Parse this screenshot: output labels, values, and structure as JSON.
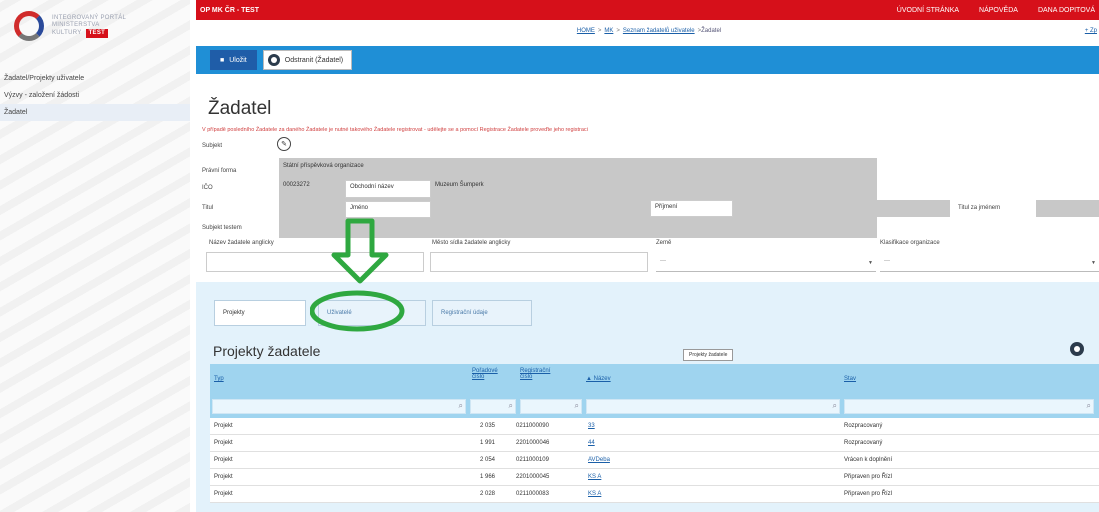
{
  "app": {
    "title": "OP MK ČR - TEST",
    "badge": "TEST",
    "logo_text": [
      "INTEGROVANÝ PORTÁL",
      "MINISTERSTVA",
      "KULTURY"
    ]
  },
  "top_links": [
    "ÚVODNÍ STRÁNKA",
    "NÁPOVĚDA",
    "DANA DOPITOVÁ"
  ],
  "breadcrumb": {
    "items": [
      "HOME",
      "MK",
      "Seznam žadatelů uživatele",
      "Žadatel"
    ],
    "right": "+ Zp"
  },
  "sidebar": {
    "items": [
      {
        "label": "Žadatel/Projekty uživatele"
      },
      {
        "label": "Výzvy - založení žádosti"
      },
      {
        "label": "Žadatel"
      }
    ]
  },
  "toolbar": {
    "save_label": "Uložit",
    "remove_label": "Odstranit (Žadatel)"
  },
  "page": {
    "title": "Žadatel",
    "warning": "V případě posledního Žadatele za daného Žadatele je nutné takového Žadatele registrovat - udělejte se a pomocí Registrace Žadatele proveďte jeho registraci"
  },
  "form": {
    "subjekt_label": "Subjekt",
    "pravni_forma_label": "Právní forma",
    "pravni_forma_value": "Státní příspěvková organizace",
    "ico_label": "IČO",
    "ico_value": "00023272",
    "obchodni_nazev_label": "Obchodní název",
    "obchodni_nazev_value": "Muzeum Šumperk",
    "jmeno_label": "Jméno",
    "prijmeni_label": "Příjmení",
    "titul_label": "Titul",
    "titul_za_label": "Titul za jménem",
    "subjekt_testem_label": "Subjekt testem",
    "nazev_anglicky_label": "Název žadatele anglicky",
    "mesto_anglicky_label": "Město sídla žadatele anglicky",
    "zeme_label": "Země",
    "zeme_value": "—",
    "klasifikace_label": "Klasifikace organizace",
    "klasifikace_value": "—"
  },
  "tabs": [
    {
      "label": "Projekty"
    },
    {
      "label": "Uživatelé"
    },
    {
      "label": "Registrační údaje"
    }
  ],
  "section": {
    "title": "Projekty žadatele",
    "tooltip": "Projekty žadatele"
  },
  "table": {
    "headers": {
      "typ": "Typ",
      "poradove": "Pořadové číslo",
      "registracni": "Registrační číslo",
      "nazev": "▲ Název",
      "stav": "Stav"
    },
    "rows": [
      {
        "typ": "Projekt",
        "poradove": "2 035",
        "registracni": "0211000090",
        "nazev": "33",
        "stav": "Rozpracovaný"
      },
      {
        "typ": "Projekt",
        "poradove": "1 991",
        "registracni": "2201000046",
        "nazev": "44",
        "stav": "Rozpracovaný"
      },
      {
        "typ": "Projekt",
        "poradove": "2 054",
        "registracni": "0211000109",
        "nazev": "AVDeba",
        "stav": "Vrácen k doplnění"
      },
      {
        "typ": "Projekt",
        "poradove": "1 966",
        "registracni": "2201000045",
        "nazev": "KS A",
        "stav": "Připraven pro Řízl"
      },
      {
        "typ": "Projekt",
        "poradove": "2 028",
        "registracni": "0211000083",
        "nazev": "KS A",
        "stav": "Připraven pro Řízl"
      }
    ]
  },
  "colors": {
    "top_bar": "#d6101a",
    "toolbar": "#1f8fd6",
    "table_header": "#9fd4ef",
    "annotation": "#2fa840"
  }
}
